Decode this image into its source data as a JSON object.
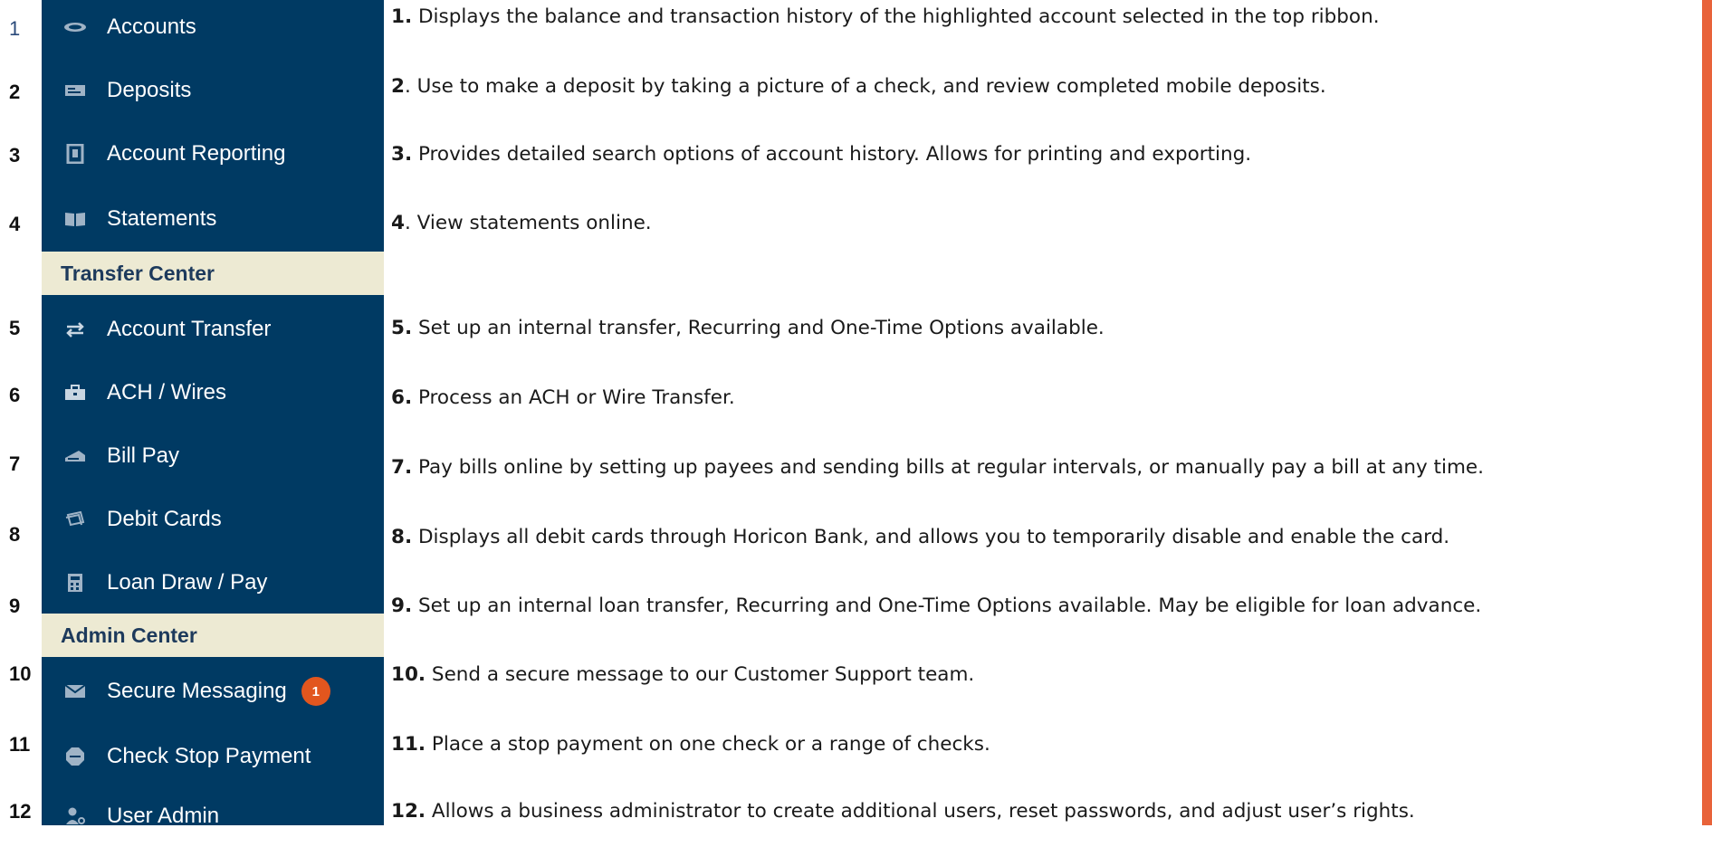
{
  "row_numbers": [
    "1",
    "2",
    "3",
    "4",
    "5",
    "6",
    "7",
    "8",
    "9",
    "10",
    "11",
    "12"
  ],
  "sidebar": {
    "items": [
      {
        "label": "Accounts",
        "icon": "money-icon"
      },
      {
        "label": "Deposits",
        "icon": "check-deposit-icon"
      },
      {
        "label": "Account Reporting",
        "icon": "report-icon"
      },
      {
        "label": "Statements",
        "icon": "book-icon"
      },
      {
        "label": "Account Transfer",
        "icon": "transfer-arrows-icon"
      },
      {
        "label": "ACH / Wires",
        "icon": "briefcase-icon"
      },
      {
        "label": "Bill Pay",
        "icon": "bill-icon"
      },
      {
        "label": "Debit Cards",
        "icon": "cards-icon"
      },
      {
        "label": "Loan Draw / Pay",
        "icon": "calculator-icon"
      },
      {
        "label": "Secure Messaging",
        "icon": "envelope-icon",
        "badge": "1"
      },
      {
        "label": "Check Stop Payment",
        "icon": "stop-sign-icon"
      },
      {
        "label": "User Admin",
        "icon": "user-gear-icon"
      }
    ],
    "sections": {
      "transfer_center": "Transfer Center",
      "admin_center": "Admin Center"
    }
  },
  "descriptions": [
    {
      "num": "1.",
      "text": " Displays the balance and transaction history of the highlighted account selected in the top ribbon."
    },
    {
      "num": "2",
      "text": ". Use to make a deposit by taking a picture of a check, and review completed mobile deposits."
    },
    {
      "num": "3.",
      "text": " Provides detailed search options of account history. Allows for printing and exporting."
    },
    {
      "num": "4",
      "text": ". View statements online."
    },
    {
      "num": "5.",
      "text": " Set up an internal transfer, Recurring and One-Time Options available."
    },
    {
      "num": "6.",
      "text": " Process an ACH or Wire Transfer."
    },
    {
      "num": "7.",
      "text": " Pay bills online by setting up payees and sending bills at regular intervals, or manually pay a bill at any time."
    },
    {
      "num": "8.",
      "text": " Displays all debit cards through Horicon Bank, and allows you to temporarily disable and enable the card."
    },
    {
      "num": "9.",
      "text": " Set up an internal loan transfer, Recurring and One-Time Options available. May be eligible for loan advance."
    },
    {
      "num": "10.",
      "text": " Send a secure message to our Customer Support team."
    },
    {
      "num": "11.",
      "text": " Place a stop payment on one check or a range of checks."
    },
    {
      "num": "12.",
      "text": " Allows a business administrator to create additional users, reset passwords, and adjust user’s rights."
    }
  ],
  "colors": {
    "sidebar_bg": "#003A63",
    "section_bg": "#EDEAD3",
    "badge": "#E2561E",
    "accent_bar": "#E8633A"
  }
}
